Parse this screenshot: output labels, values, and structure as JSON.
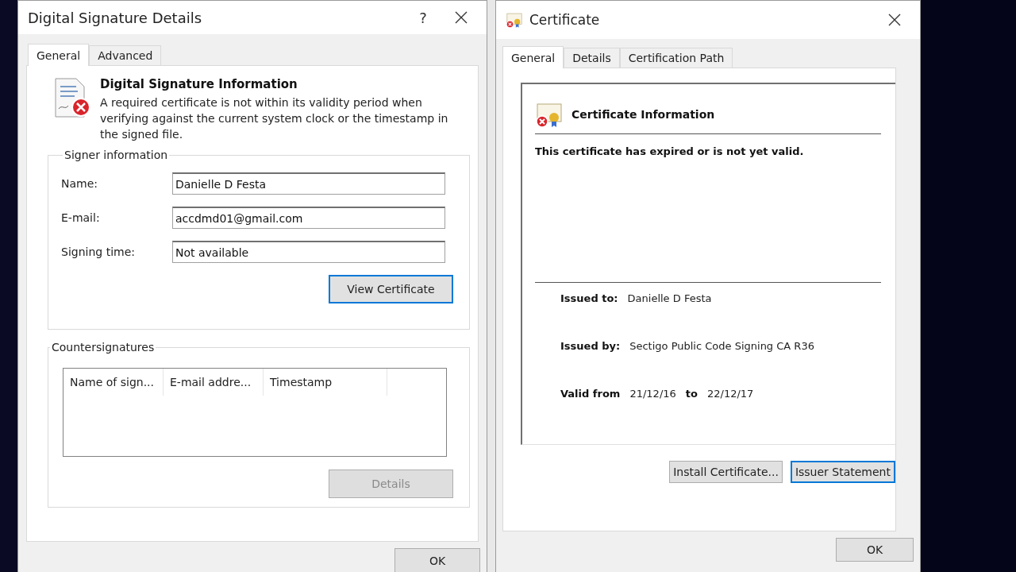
{
  "signature_dialog": {
    "title": "Digital Signature Details",
    "help": "?",
    "tabs": [
      {
        "label": "General",
        "selected": true
      },
      {
        "label": "Advanced",
        "selected": false
      }
    ],
    "heading": "Digital Signature Information",
    "message": "A required certificate is not within its validity period when verifying against the current system clock or the timestamp in the signed file.",
    "signer_information": {
      "legend": "Signer information",
      "fields": [
        {
          "label": "Name:",
          "value": "Danielle D Festa"
        },
        {
          "label": "E-mail:",
          "value": "accdmd01@gmail.com"
        },
        {
          "label": "Signing time:",
          "value": "Not available"
        }
      ],
      "button": {
        "label": "View Certificate",
        "focused": true,
        "disabled": false
      }
    },
    "countersignatures": {
      "legend": "Countersignatures",
      "columns": [
        "Name of sign...",
        "E-mail addre...",
        "Timestamp"
      ],
      "button": {
        "label": "Details",
        "focused": false,
        "disabled": true
      }
    },
    "ok_button": "OK"
  },
  "certificate_dialog": {
    "title": "Certificate",
    "tabs": [
      {
        "label": "General",
        "selected": true
      },
      {
        "label": "Details",
        "selected": false
      },
      {
        "label": "Certification Path",
        "selected": false
      }
    ],
    "heading": "Certificate Information",
    "status": "This certificate has expired or is not yet valid.",
    "issued_to": {
      "label": "Issued to:",
      "value": "Danielle D Festa"
    },
    "issued_by": {
      "label": "Issued by:",
      "value": "Sectigo Public Code Signing CA R36"
    },
    "validity": {
      "label": "Valid from",
      "from": "21/12/16",
      "to_label": "to",
      "to": "22/12/17"
    },
    "buttons": [
      {
        "label": "Install Certificate...",
        "focused": false,
        "disabled": false
      },
      {
        "label": "Issuer Statement",
        "focused": true,
        "disabled": false
      }
    ],
    "ok_button": "OK"
  }
}
